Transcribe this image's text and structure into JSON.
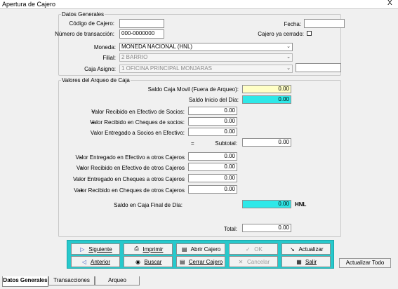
{
  "window": {
    "title": "Apertura de Cajero",
    "close_symbol": "X"
  },
  "datos_generales": {
    "legend": "Datos Generales",
    "codigo_label": "Código de Cajero:",
    "codigo_value": "",
    "transaccion_label": "Número de transacción:",
    "transaccion_value": "000-0000000",
    "fecha_label": "Fecha:",
    "fecha_value": "",
    "cerrado_label": "Cajero ya cerrado:",
    "cerrado_checked": false,
    "moneda_label": "Moneda:",
    "moneda_value": "MONEDA NACIONAL (HNL)",
    "filial_label": "Filial:",
    "filial_value": "2 BARRIO",
    "caja_label": "Caja Asigno:",
    "caja_value": "1 OFICINA PRINCIPAL MONJARAS",
    "caja_extra_value": ""
  },
  "valores": {
    "legend": "Valores del Arqueo de Caja",
    "saldo_movil_label": "Saldo Caja Movil (Fuera de Arqueo):",
    "saldo_movil_value": "0.00",
    "saldo_inicio_label": "Saldo Inicio del Día:",
    "saldo_inicio_value": "0.00",
    "recibido_efectivo_sign": "+",
    "recibido_efectivo_label": "Valor Recibido en Efectivo de Socios:",
    "recibido_efectivo_value": "0.00",
    "recibido_cheques_sign": "+",
    "recibido_cheques_label": "Valor Recibido en Cheques de socios:",
    "recibido_cheques_value": "0.00",
    "entregado_socios_label": "Valor Entregado a Socios en Efectivo:",
    "entregado_socios_value": "0.00",
    "subtotal_sign": "=",
    "subtotal_label": "Subtotal:",
    "subtotal_value": "0.00",
    "entregado_ef_otros_sign": "-",
    "entregado_ef_otros_label": "Valor Entregado en Efectivo a otros Cajeros",
    "entregado_ef_otros_value": "0.00",
    "recibido_ef_otros_sign": "+",
    "recibido_ef_otros_label": "Valor Recibido en Efectivo de otros Cajeros",
    "recibido_ef_otros_value": "0.00",
    "entregado_ch_otros_sign": "-",
    "entregado_ch_otros_label": "Valor Entregado en Cheques a otros Cajeros",
    "entregado_ch_otros_value": "0.00",
    "recibido_ch_otros_sign": "+",
    "recibido_ch_otros_label": "Valor Recibido en Cheques de otros Cajeros",
    "recibido_ch_otros_value": "0.00",
    "saldo_final_label": "Saldo en Caja Final de Día:",
    "saldo_final_value": "0.00",
    "saldo_final_currency": "HNL",
    "total_label": "Total:",
    "total_value": "0.00"
  },
  "toolbar": {
    "siguiente": "Siguiente",
    "imprimir": "Imprimir",
    "abrir": "Abrir Cajero",
    "ok": "OK",
    "actualizar": "Actualizar",
    "anterior": "Anterior",
    "buscar": "Buscar",
    "cerrar": "Cerrar Cajero",
    "cancelar": "Cancelar",
    "salir": "Salir"
  },
  "actualizar_todo": "Actualizar Todo",
  "tabs": [
    "Datos Generales",
    "Transacciones",
    "Arqueo"
  ],
  "colors": {
    "toolbar": "#27c9cc",
    "highlight_yellow": "#ffffc6",
    "highlight_cyan": "#2ee8e8"
  }
}
